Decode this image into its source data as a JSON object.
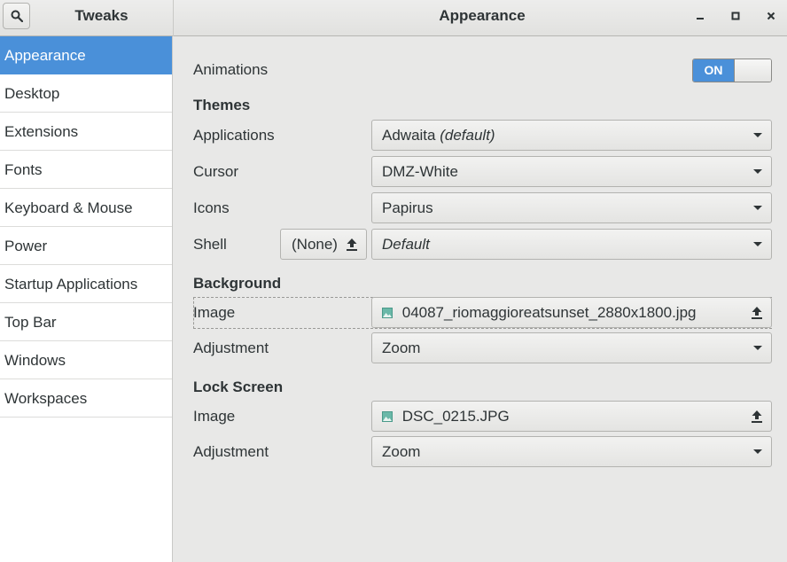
{
  "app": {
    "title": "Tweaks"
  },
  "header": {
    "title": "Appearance"
  },
  "icons": {
    "search": "search-icon",
    "minimize": "minimize-icon",
    "maximize": "maximize-icon",
    "close": "close-icon",
    "dropdown": "chevron-down-icon",
    "upload": "upload-icon",
    "image": "image-icon"
  },
  "colors": {
    "accent": "#4a90d9",
    "sidebar_bg": "#ffffff",
    "content_bg": "#e8e8e7"
  },
  "sidebar": {
    "items": [
      {
        "label": "Appearance",
        "active": true
      },
      {
        "label": "Desktop"
      },
      {
        "label": "Extensions"
      },
      {
        "label": "Fonts"
      },
      {
        "label": "Keyboard & Mouse"
      },
      {
        "label": "Power"
      },
      {
        "label": "Startup Applications"
      },
      {
        "label": "Top Bar"
      },
      {
        "label": "Windows"
      },
      {
        "label": "Workspaces"
      }
    ]
  },
  "main": {
    "animations": {
      "label": "Animations",
      "toggle_label": "ON",
      "enabled": true
    },
    "themes": {
      "heading": "Themes",
      "applications": {
        "label": "Applications",
        "value": "Adwaita",
        "suffix": "(default)"
      },
      "cursor": {
        "label": "Cursor",
        "value": "DMZ-White"
      },
      "icons": {
        "label": "Icons",
        "value": "Papirus"
      },
      "shell": {
        "label": "Shell",
        "button": "(None)",
        "value": "Default"
      }
    },
    "background": {
      "heading": "Background",
      "image": {
        "label": "Image",
        "value": "04087_riomaggioreatsunset_2880x1800.jpg"
      },
      "adjustment": {
        "label": "Adjustment",
        "value": "Zoom"
      }
    },
    "lock_screen": {
      "heading": "Lock Screen",
      "image": {
        "label": "Image",
        "value": "DSC_0215.JPG"
      },
      "adjustment": {
        "label": "Adjustment",
        "value": "Zoom"
      }
    }
  }
}
